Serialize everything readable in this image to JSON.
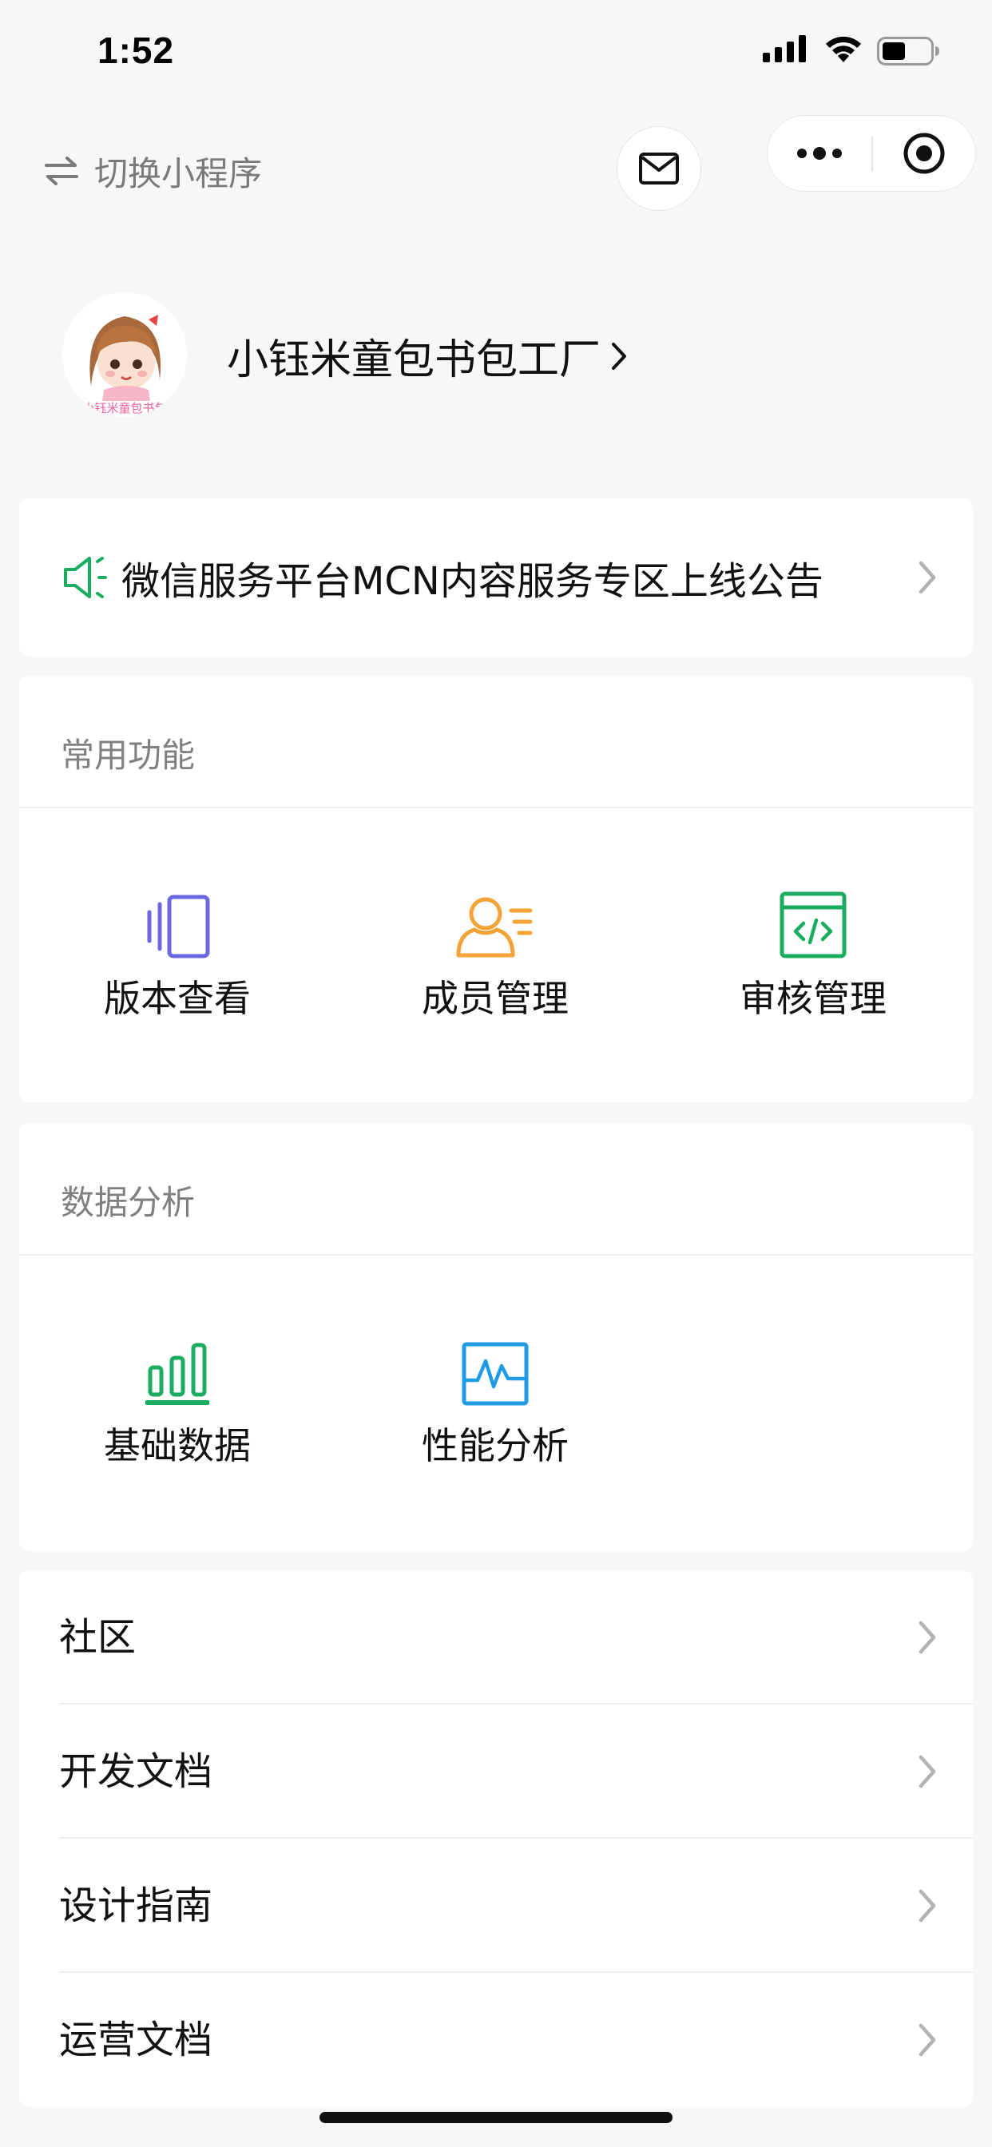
{
  "status_bar": {
    "time": "1:52"
  },
  "nav": {
    "switch_label": "切换小程序"
  },
  "profile": {
    "name": "小钰米童包书包工厂",
    "chevron": "›"
  },
  "notice": {
    "text": "微信服务平台MCN内容服务专区上线公告"
  },
  "sections": {
    "common": {
      "title": "常用功能",
      "items": [
        {
          "label": "版本查看",
          "icon": "version-icon",
          "color": "#6a68e0"
        },
        {
          "label": "成员管理",
          "icon": "member-icon",
          "color": "#f5a236"
        },
        {
          "label": "审核管理",
          "icon": "review-code-icon",
          "color": "#1aad60"
        }
      ]
    },
    "data": {
      "title": "数据分析",
      "items": [
        {
          "label": "基础数据",
          "icon": "bar-chart-icon",
          "color": "#1aad60"
        },
        {
          "label": "性能分析",
          "icon": "performance-icon",
          "color": "#1f9be6"
        }
      ]
    }
  },
  "list": [
    {
      "label": "社区"
    },
    {
      "label": "开发文档"
    },
    {
      "label": "设计指南"
    },
    {
      "label": "运营文档"
    }
  ],
  "colors": {
    "accent_green": "#1aad60",
    "background": "#f7f7f7"
  }
}
